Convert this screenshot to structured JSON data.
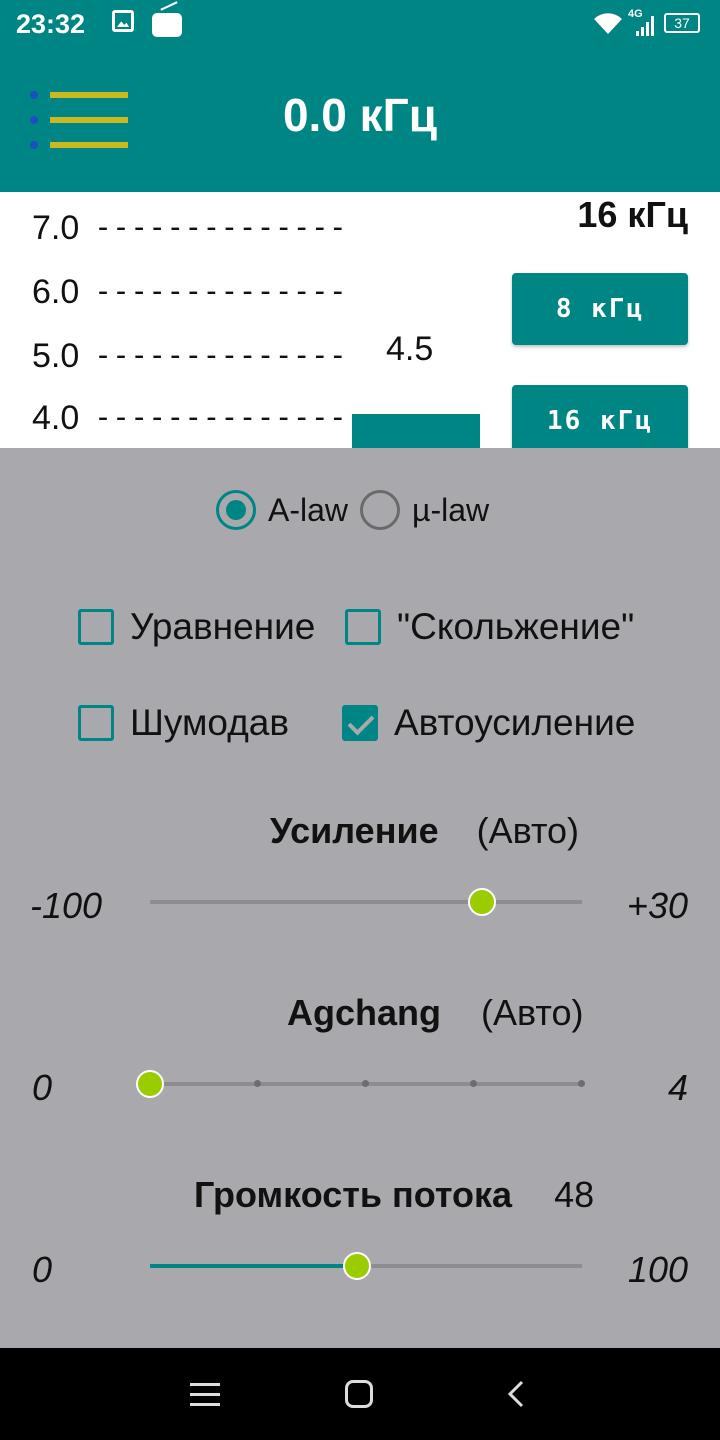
{
  "status_bar": {
    "time": "23:32",
    "network": "4G",
    "battery": "37",
    "icons": [
      "image-icon",
      "radio-icon",
      "wifi-icon",
      "signal-icon",
      "battery-icon"
    ]
  },
  "app_bar": {
    "title": "0.0 кГц",
    "menu_icon": "hamburger-icon"
  },
  "meter": {
    "scale": [
      {
        "label": "7.0",
        "dashes": "--------------"
      },
      {
        "label": "6.0",
        "dashes": "--------------"
      },
      {
        "label": "5.0",
        "dashes": "--------------"
      },
      {
        "label": "4.0",
        "dashes": "--------------"
      }
    ],
    "value": "4.5",
    "current_rate": "16 кГц",
    "rate_buttons": [
      "8 кГц",
      "16 кГц"
    ]
  },
  "codec": {
    "options": [
      {
        "label": "A-law",
        "selected": true
      },
      {
        "label": "µ-law",
        "selected": false
      }
    ]
  },
  "options": [
    {
      "label": "Уравнение",
      "checked": false
    },
    {
      "label": "\"Скольжение\"",
      "checked": false
    },
    {
      "label": "Шумодав",
      "checked": false
    },
    {
      "label": "Автоусиление",
      "checked": true
    }
  ],
  "gain": {
    "title": "Усиление",
    "mode": "(Авто)",
    "min": "-100",
    "max": "+30",
    "value": 5
  },
  "agchang": {
    "title": "Agchang",
    "mode": "(Авто)",
    "min": "0",
    "max": "4",
    "value": 0
  },
  "volume": {
    "title": "Громкость потока",
    "value_text": "48",
    "min": "0",
    "max": "100",
    "value": 48
  },
  "colors": {
    "primary": "#008585",
    "panel": "#a9a9ad",
    "thumb": "#9acd00",
    "menu_bar": "#c9b81e"
  }
}
